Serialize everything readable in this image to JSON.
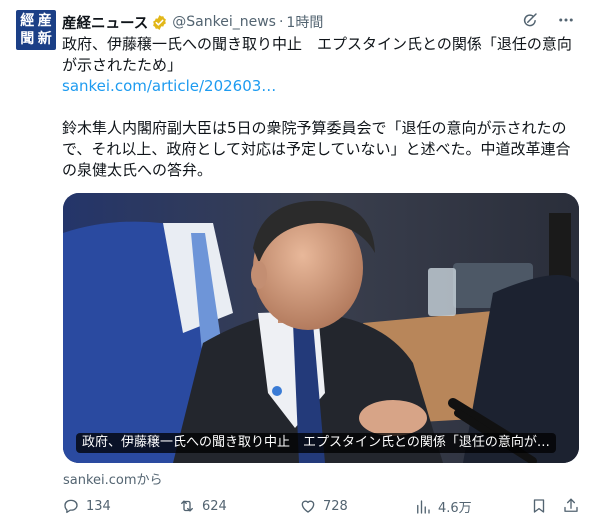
{
  "tweet": {
    "author": {
      "name": "産経ニュース",
      "handle": "@Sankei_news",
      "separator": "·",
      "time": "1時間",
      "avatar_chars": [
        "經",
        "産",
        "聞",
        "新"
      ]
    },
    "headline": "政府、伊藤穣一氏への聞き取り中止　エプスタイン氏との関係「退任の意向が示されたため」",
    "link_text": "sankei.com/article/202603…",
    "paragraph": "鈴木隼人内閣府副大臣は5日の衆院予算委員会で「退任の意向が示されたので、それ以上、政府として対応は予定していない」と述べた。中道改革連合の泉健太氏への答弁。",
    "card": {
      "caption": "政府、伊藤穣一氏への聞き取り中止　エプスタイン氏との関係「退任の意向が…"
    },
    "source_text": "sankei.comから",
    "stats": {
      "replies": "134",
      "reposts": "624",
      "likes": "728",
      "views": "4.6万"
    },
    "icons": [
      "verified-badge-icon",
      "grok-icon",
      "more-icon",
      "reply-icon",
      "repost-icon",
      "like-icon",
      "views-icon",
      "bookmark-icon",
      "share-icon"
    ],
    "colors": {
      "link": "#1d9bf0",
      "verified": "#e2b719",
      "secondary_text": "#536471",
      "avatar_bg": "#1b3f86"
    }
  }
}
